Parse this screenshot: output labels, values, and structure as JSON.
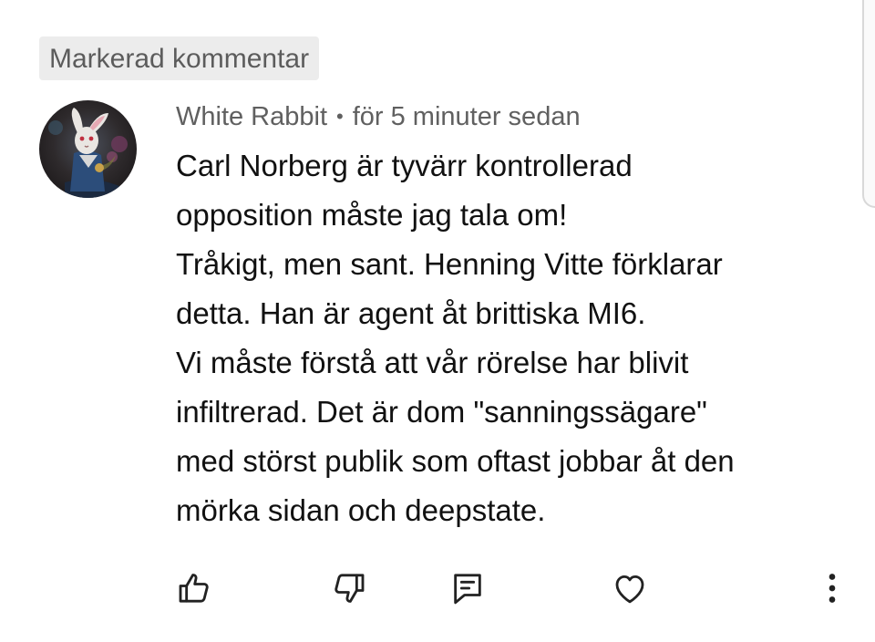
{
  "badge": {
    "label": "Markerad kommentar"
  },
  "comment": {
    "author": "White Rabbit",
    "separator": "•",
    "time": "för 5 minuter sedan",
    "lines": [
      "Carl Norberg är tyvärr kontrollerad",
      "opposition måste jag tala om!",
      "Tråkigt, men sant. Henning Vitte förklarar",
      "detta. Han är agent åt brittiska MI6.",
      "Vi måste förstå att vår rörelse har blivit",
      "infiltrerad. Det är dom \"sanningssägare\"",
      "med störst publik som oftast jobbar åt den",
      "mörka sidan och deepstate."
    ]
  },
  "actions": {
    "like_icon": "thumbs-up-icon",
    "dislike_icon": "thumbs-down-icon",
    "reply_icon": "comment-icon",
    "heart_icon": "heart-icon",
    "more_icon": "more-vertical-icon"
  },
  "colors": {
    "badge_bg": "#ececec",
    "meta_text": "#606060",
    "body_text": "#111111",
    "icon": "#222222"
  }
}
